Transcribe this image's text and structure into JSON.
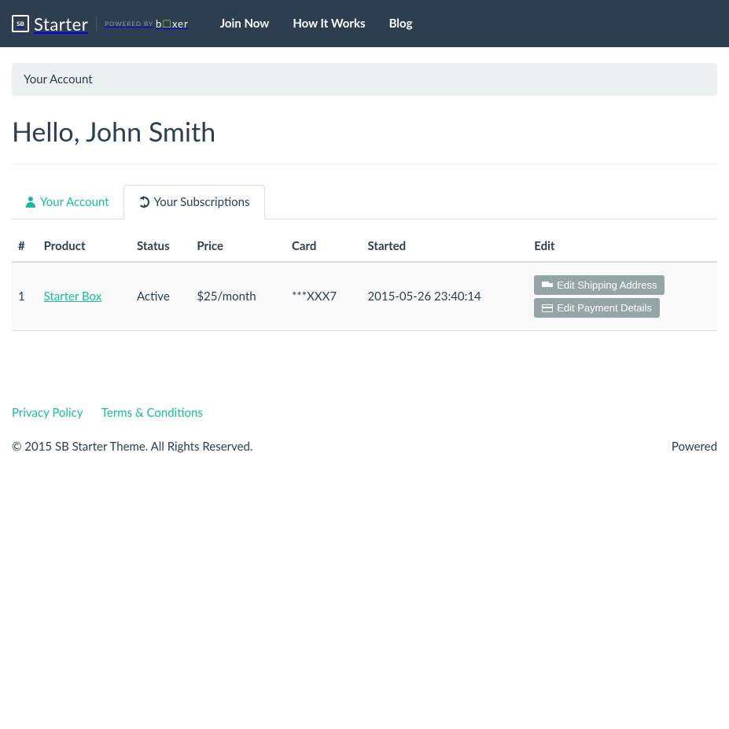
{
  "nav": {
    "brand_main": "Starter",
    "brand_powered_prefix": "POWERED BY",
    "links": [
      "Join Now",
      "How It Works",
      "Blog"
    ]
  },
  "breadcrumb": "Your Account",
  "page_title": "Hello, John Smith",
  "tabs": {
    "account": "Your Account",
    "subscriptions": "Your Subscriptions"
  },
  "table": {
    "headers": [
      "#",
      "Product",
      "Status",
      "Price",
      "Card",
      "Started",
      "Edit"
    ],
    "rows": [
      {
        "num": "1",
        "product": "Starter Box",
        "status": "Active",
        "price": "$25/month",
        "card": "***XXX7",
        "started": "2015-05-26 23:40:14",
        "edit_shipping": "Edit Shipping Address",
        "edit_payment": "Edit Payment Details"
      }
    ]
  },
  "footer": {
    "privacy": "Privacy Policy",
    "terms": "Terms & Conditions",
    "copyright": "© 2015 SB Starter Theme. All Rights Reserved.",
    "powered": "Powered"
  }
}
